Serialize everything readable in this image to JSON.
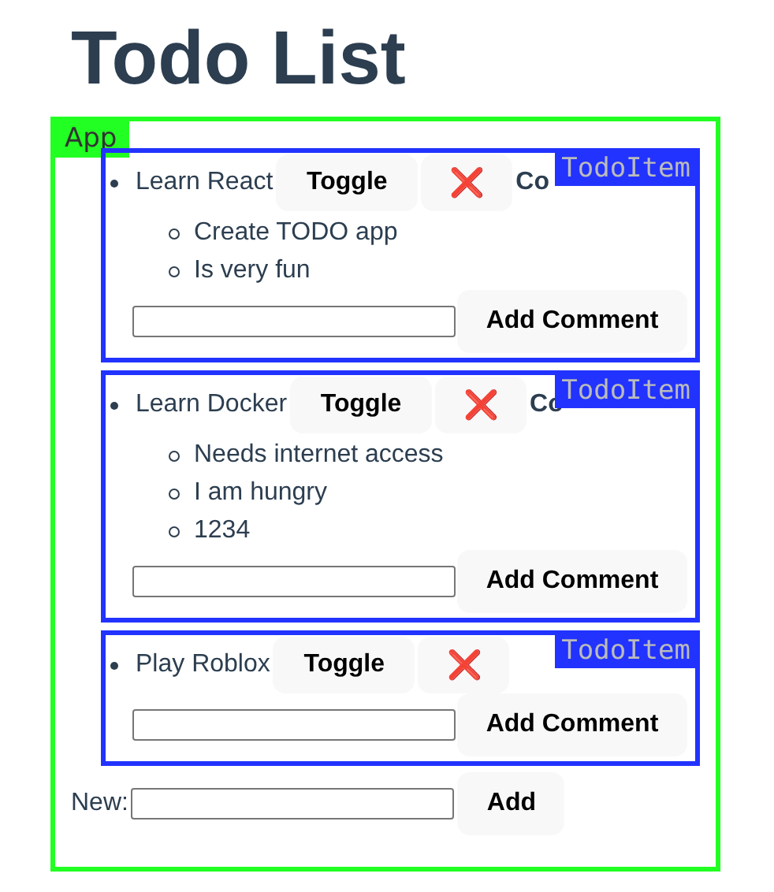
{
  "title": "Todo List",
  "app_label": "App",
  "todos": [
    {
      "text": "Learn React",
      "toggle": "Toggle",
      "remove": "❌",
      "comments_heading": "Co",
      "component_label": "TodoItem",
      "comments": [
        "Create TODO app",
        "Is very fun"
      ],
      "add_comment": "Add Comment"
    },
    {
      "text": "Learn Docker",
      "toggle": "Toggle",
      "remove": "❌",
      "comments_heading": "Co",
      "component_label": "TodoItem",
      "comments": [
        "Needs internet access",
        "I am hungry",
        "1234"
      ],
      "add_comment": "Add Comment"
    },
    {
      "text": "Play Roblox",
      "toggle": "Toggle",
      "remove": "❌",
      "component_label": "TodoItem",
      "add_comment": "Add Comment"
    }
  ],
  "new_label": "New:",
  "add_button": "Add"
}
